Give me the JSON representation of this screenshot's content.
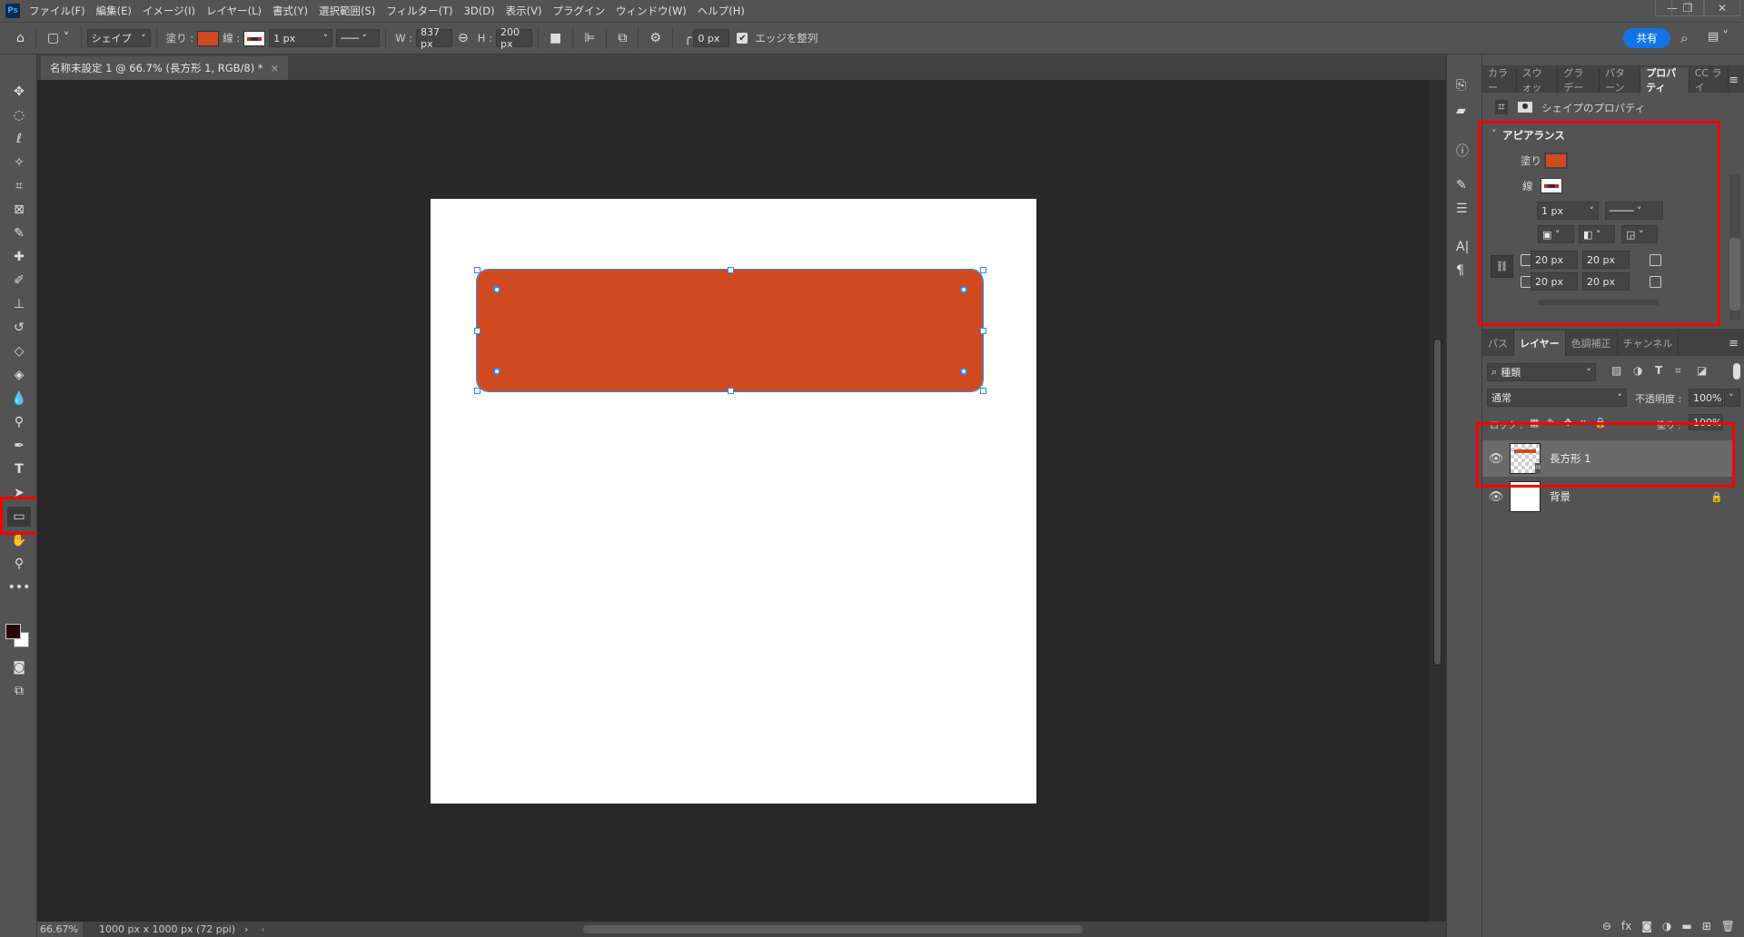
{
  "app": {
    "logo": "Ps",
    "menu": [
      "ファイル(F)",
      "編集(E)",
      "イメージ(I)",
      "レイヤー(L)",
      "書式(Y)",
      "選択範囲(S)",
      "フィルター(T)",
      "3D(D)",
      "表示(V)",
      "プラグイン",
      "ウィンドウ(W)",
      "ヘルプ(H)"
    ]
  },
  "window": {
    "minimize": "—",
    "restore": "❐",
    "close": "✕"
  },
  "options": {
    "mode": "シェイプ",
    "fill_label": "塗り :",
    "stroke_label": "線 :",
    "stroke_width": "1 px",
    "w_label": "W :",
    "width": "837 px",
    "h_label": "H :",
    "height": "200 px",
    "radius": "0 px",
    "align_edges": "エッジを整列",
    "share": "共有",
    "fill_color": "#d04a20"
  },
  "document": {
    "tab_title": "名称未設定 1 @ 66.7% (長方形 1, RGB/8) *",
    "close": "×",
    "zoom": "66.67%",
    "size_info": "1000 px x 1000 px (72 ppi)"
  },
  "properties_panel": {
    "tabs": [
      "カラー",
      "スウォッ",
      "グラデー",
      "パターン",
      "プロパティ",
      "CC ライ"
    ],
    "active_tab": "プロパティ",
    "header": "シェイプのプロパティ",
    "section": "アピアランス",
    "fill_label": "塗り",
    "stroke_label": "線",
    "stroke_width": "1 px",
    "corners": [
      "20 px",
      "20 px",
      "20 px",
      "20 px"
    ]
  },
  "layers_panel": {
    "tabs": [
      "パス",
      "レイヤー",
      "色調補正",
      "チャンネル"
    ],
    "active_tab": "レイヤー",
    "filter": "種類",
    "blend_mode": "通常",
    "opacity_label": "不透明度 :",
    "opacity": "100%",
    "lock_label": "ロック :",
    "fill_label": "塗り :",
    "fill": "100%",
    "layers": [
      {
        "name": "長方形 1",
        "selected": true
      },
      {
        "name": "背景",
        "locked": true
      }
    ]
  },
  "highlight_color": "#ff0000"
}
